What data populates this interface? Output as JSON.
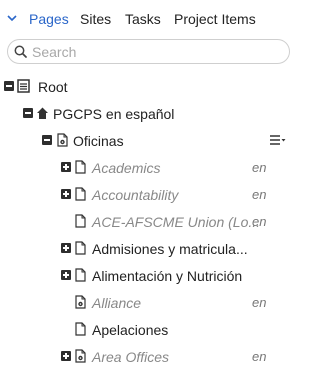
{
  "tabs": {
    "items": [
      "Pages",
      "Sites",
      "Tasks",
      "Project Items"
    ],
    "active": "Pages"
  },
  "search": {
    "placeholder": "Search"
  },
  "tree": [
    {
      "label": "Root",
      "icon": "list-icon",
      "toggle": "minus"
    },
    {
      "label": "PGCPS en español",
      "icon": "home-icon",
      "toggle": "minus"
    },
    {
      "label": "Oficinas",
      "icon": "page-gear-icon",
      "toggle": "minus",
      "menu": "menu-dropdown-icon"
    },
    {
      "label": "Academics",
      "icon": "page-icon",
      "toggle": "plus",
      "italic": true,
      "lang": "en"
    },
    {
      "label": "Accountability",
      "icon": "page-icon",
      "toggle": "plus",
      "italic": true,
      "lang": "en"
    },
    {
      "label": "ACE-AFSCME Union (Lo...",
      "icon": "page-icon",
      "toggle": "none",
      "italic": true,
      "lang": "en"
    },
    {
      "label": "Admisiones y matricula...",
      "icon": "page-icon",
      "toggle": "plus"
    },
    {
      "label": "Alimentación y Nutrición",
      "icon": "page-icon",
      "toggle": "plus"
    },
    {
      "label": "Alliance",
      "icon": "page-gear-icon",
      "toggle": "none",
      "italic": true,
      "lang": "en"
    },
    {
      "label": "Apelaciones",
      "icon": "page-icon",
      "toggle": "none"
    },
    {
      "label": "Area Offices",
      "icon": "page-gear-icon",
      "toggle": "plus",
      "italic": true,
      "lang": "en"
    }
  ]
}
